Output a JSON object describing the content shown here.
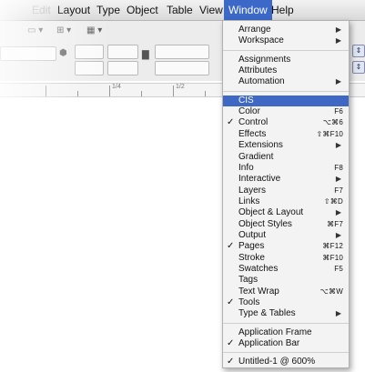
{
  "menubar": {
    "items": [
      "Edit",
      "Layout",
      "Type",
      "Object",
      "Table",
      "View",
      "Window",
      "Help"
    ],
    "active": "Window"
  },
  "controlbar": {
    "ruler_labels": [
      "1/4",
      "1/2"
    ]
  },
  "window_menu": {
    "groups": [
      [
        {
          "label": "Arrange",
          "submenu": true
        },
        {
          "label": "Workspace",
          "submenu": true
        }
      ],
      [
        {
          "label": "Assignments"
        },
        {
          "label": "Attributes"
        },
        {
          "label": "Automation",
          "submenu": true
        }
      ],
      [
        {
          "label": "CIS",
          "highlighted": true
        },
        {
          "label": "Color",
          "shortcut": "F6"
        },
        {
          "label": "Control",
          "checked": true,
          "shortcut": "⌥⌘6"
        },
        {
          "label": "Effects",
          "shortcut": "⇧⌘F10"
        },
        {
          "label": "Extensions",
          "submenu": true
        },
        {
          "label": "Gradient"
        },
        {
          "label": "Info",
          "shortcut": "F8"
        },
        {
          "label": "Interactive",
          "submenu": true
        },
        {
          "label": "Layers",
          "shortcut": "F7"
        },
        {
          "label": "Links",
          "shortcut": "⇧⌘D"
        },
        {
          "label": "Object & Layout",
          "submenu": true
        },
        {
          "label": "Object Styles",
          "shortcut": "⌘F7"
        },
        {
          "label": "Output",
          "submenu": true
        },
        {
          "label": "Pages",
          "checked": true,
          "shortcut": "⌘F12"
        },
        {
          "label": "Stroke",
          "shortcut": "⌘F10"
        },
        {
          "label": "Swatches",
          "shortcut": "F5"
        },
        {
          "label": "Tags"
        },
        {
          "label": "Text Wrap",
          "shortcut": "⌥⌘W"
        },
        {
          "label": "Tools",
          "checked": true
        },
        {
          "label": "Type & Tables",
          "submenu": true
        }
      ],
      [
        {
          "label": "Application Frame"
        },
        {
          "label": "Application Bar",
          "checked": true
        }
      ],
      [
        {
          "label": "Untitled-1 @ 600%",
          "checked": true
        }
      ]
    ]
  }
}
